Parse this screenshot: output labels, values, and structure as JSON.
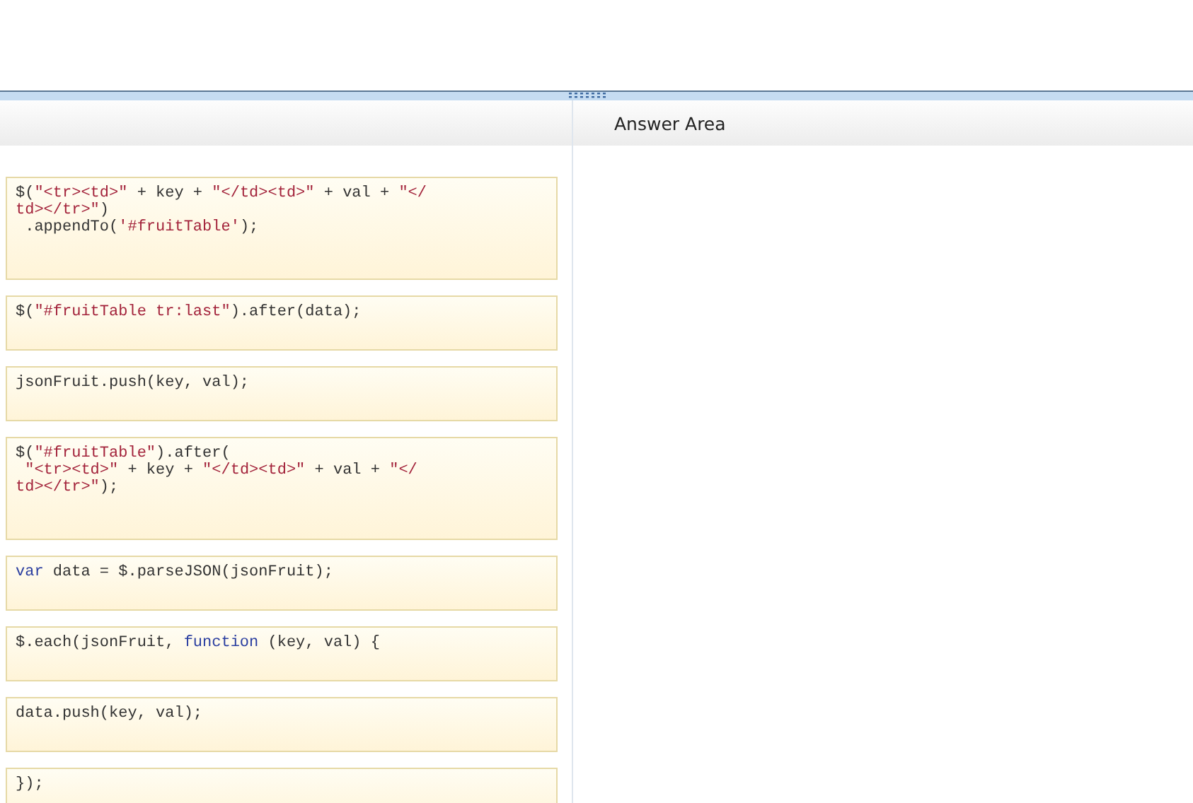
{
  "answer_area": {
    "title": "Answer Area"
  },
  "code_blocks": [
    {
      "lines": [
        [
          {
            "text": "$(",
            "kind": "plain"
          },
          {
            "text": "\"<tr><td>\"",
            "kind": "string"
          },
          {
            "text": " + key + ",
            "kind": "plain"
          },
          {
            "text": "\"</td><td>\"",
            "kind": "string"
          },
          {
            "text": " + val + ",
            "kind": "plain"
          },
          {
            "text": "\"</",
            "kind": "string"
          }
        ],
        [
          {
            "text": "td></tr>\"",
            "kind": "string"
          },
          {
            "text": ")",
            "kind": "plain"
          }
        ],
        [
          {
            "text": " .appendTo(",
            "kind": "plain"
          },
          {
            "text": "'#fruitTable'",
            "kind": "string"
          },
          {
            "text": ");",
            "kind": "plain"
          }
        ]
      ]
    },
    {
      "lines": [
        [
          {
            "text": "$(",
            "kind": "plain"
          },
          {
            "text": "\"#fruitTable tr:last\"",
            "kind": "string"
          },
          {
            "text": ").after(data);",
            "kind": "plain"
          }
        ]
      ]
    },
    {
      "lines": [
        [
          {
            "text": "jsonFruit.push(key, val);",
            "kind": "plain"
          }
        ]
      ]
    },
    {
      "lines": [
        [
          {
            "text": "$(",
            "kind": "plain"
          },
          {
            "text": "\"#fruitTable\"",
            "kind": "string"
          },
          {
            "text": ").after(",
            "kind": "plain"
          }
        ],
        [
          {
            "text": " \"<tr><td>\"",
            "kind": "string"
          },
          {
            "text": " + key + ",
            "kind": "plain"
          },
          {
            "text": "\"</td><td>\"",
            "kind": "string"
          },
          {
            "text": " + val + ",
            "kind": "plain"
          },
          {
            "text": "\"</",
            "kind": "string"
          }
        ],
        [
          {
            "text": "td></tr>\"",
            "kind": "string"
          },
          {
            "text": ");",
            "kind": "plain"
          }
        ]
      ]
    },
    {
      "lines": [
        [
          {
            "text": "var",
            "kind": "keyword"
          },
          {
            "text": " data = $.parseJSON(jsonFruit);",
            "kind": "plain"
          }
        ]
      ]
    },
    {
      "lines": [
        [
          {
            "text": "$.each(jsonFruit, ",
            "kind": "plain"
          },
          {
            "text": "function",
            "kind": "keyword"
          },
          {
            "text": " (key, val) {",
            "kind": "plain"
          }
        ]
      ]
    },
    {
      "lines": [
        [
          {
            "text": "data.push(key, val);",
            "kind": "plain"
          }
        ]
      ]
    },
    {
      "lines": [
        [
          {
            "text": "});",
            "kind": "plain"
          }
        ]
      ]
    }
  ]
}
